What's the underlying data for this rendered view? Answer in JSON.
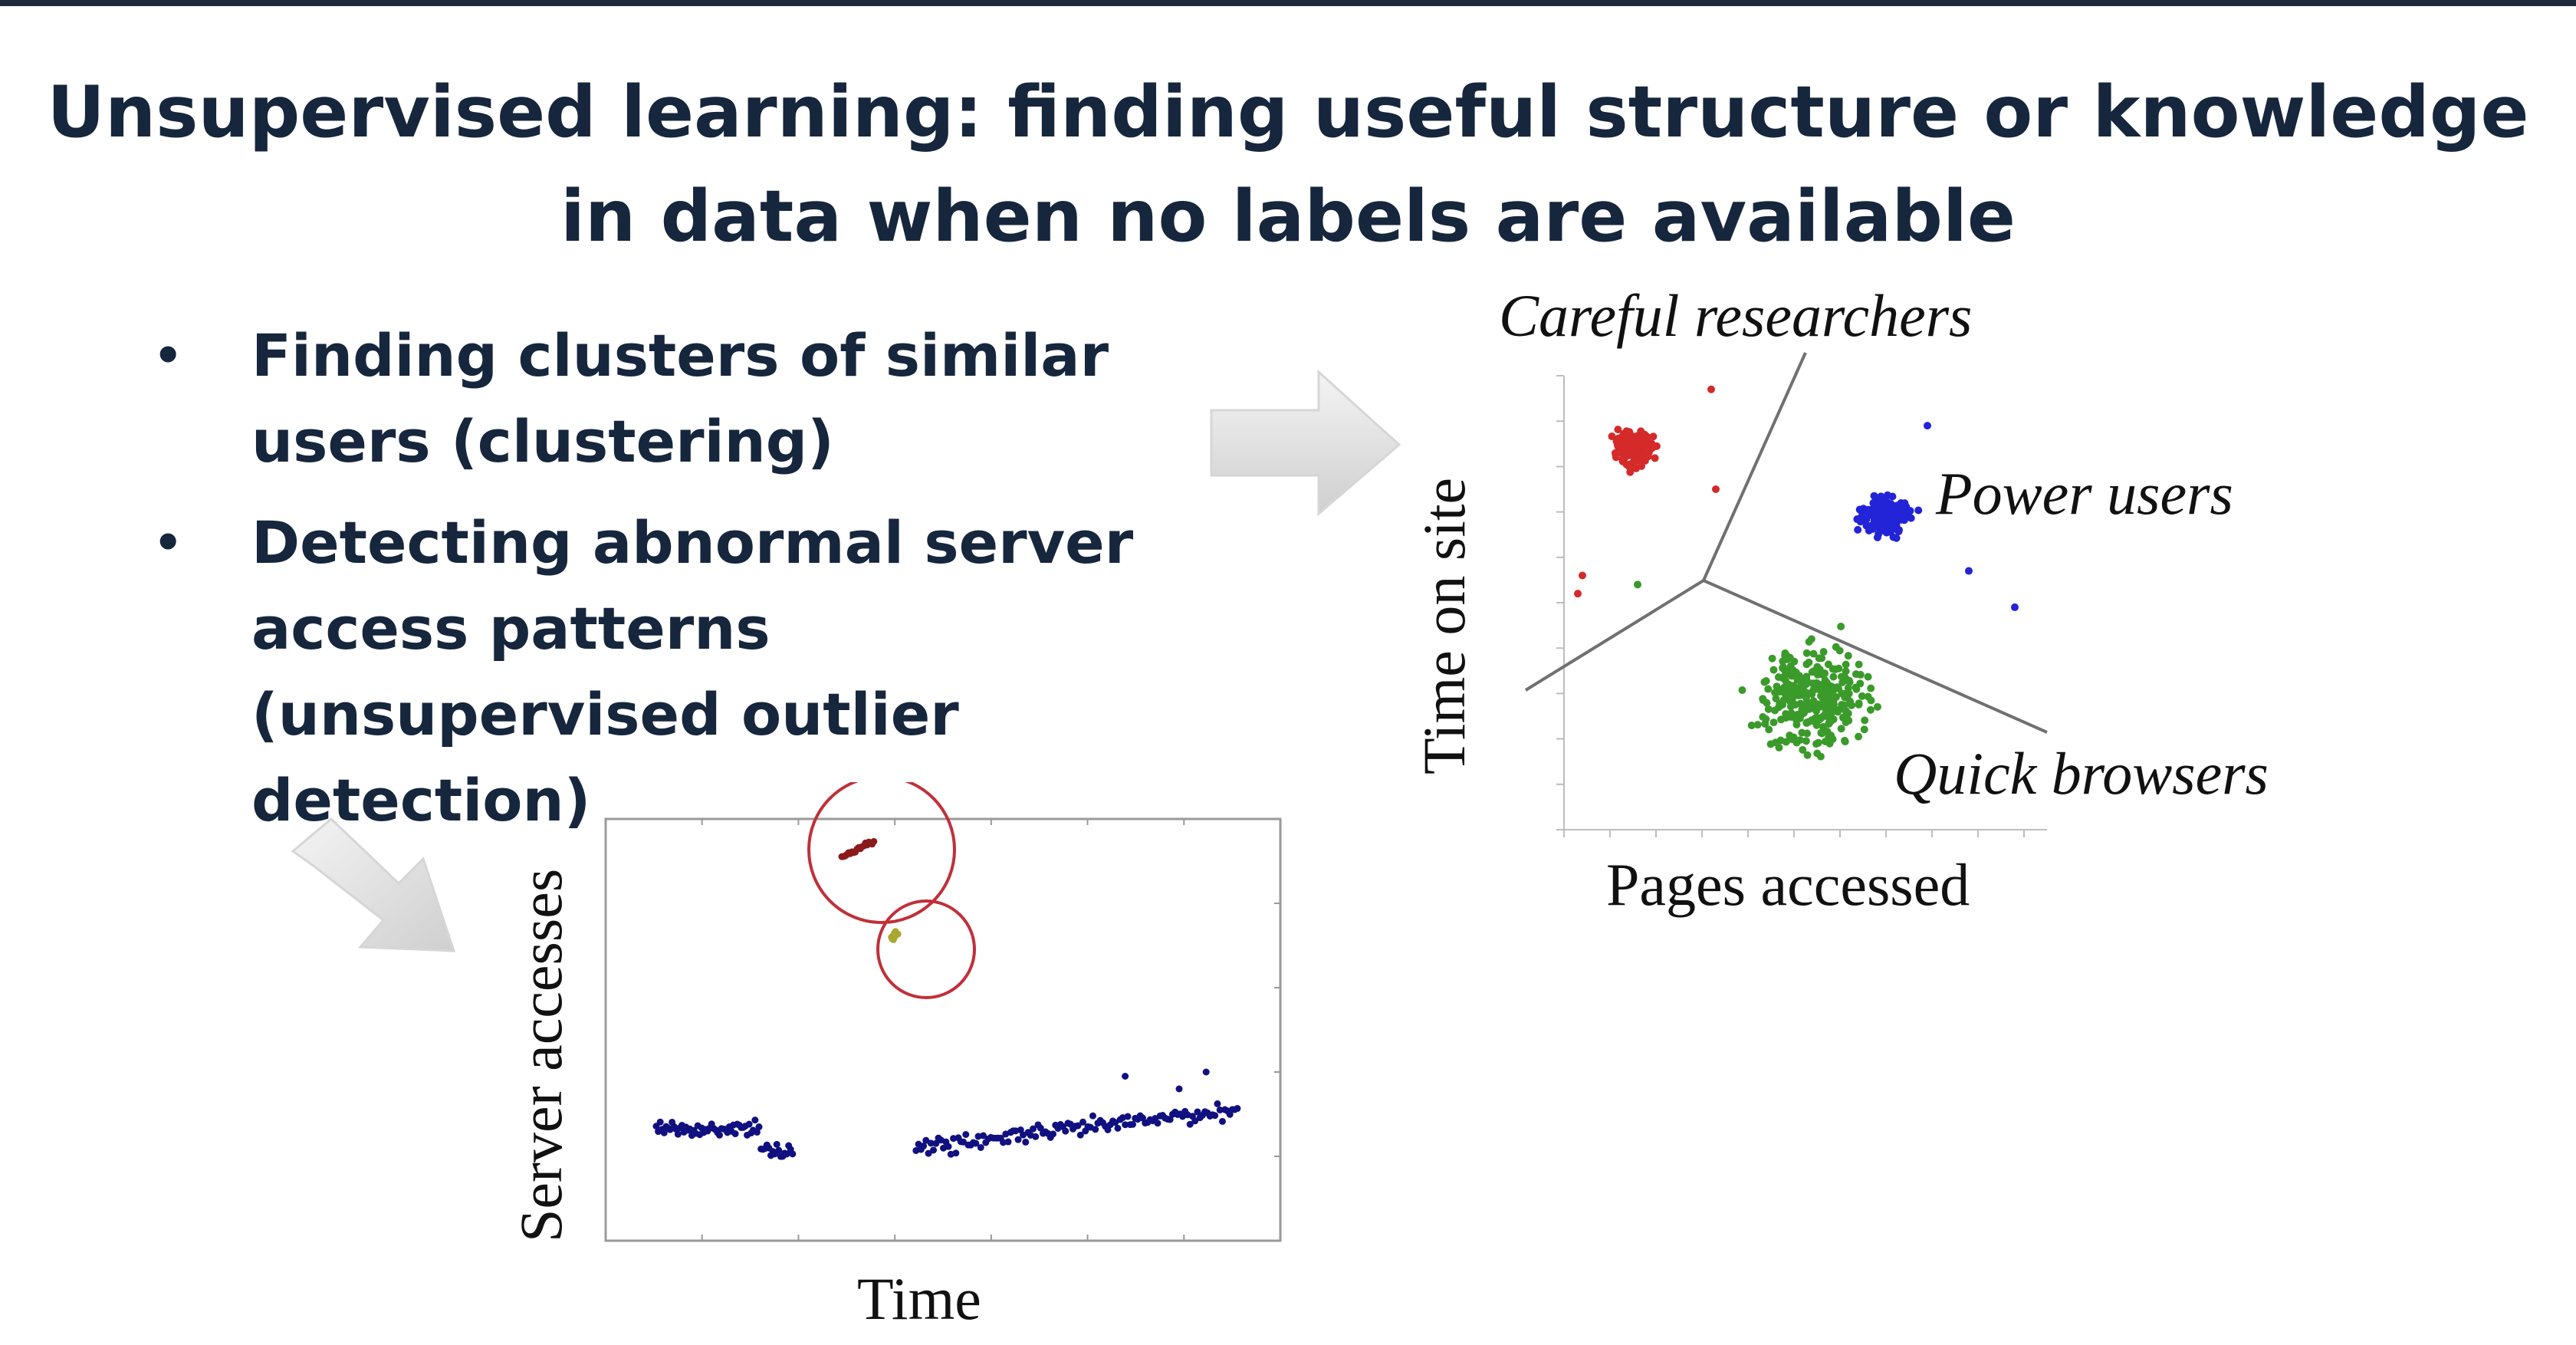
{
  "slide": {
    "title_lines": [
      "Unsupervised learning: finding useful structure or knowledge",
      "in data when no labels are available"
    ],
    "bullets": [
      {
        "lines": [
          "Finding clusters of similar",
          "users (clustering)"
        ]
      },
      {
        "lines": [
          "Detecting abnormal server",
          "access patterns",
          "(unsupervised outlier",
          "detection)"
        ]
      }
    ],
    "bullet_glyph": "•"
  },
  "colors": {
    "text": "#16263c",
    "red": "#d42a2a",
    "blue": "#2323d8",
    "green": "#3a9a2a",
    "dark_red": "#8b1a1a",
    "navy": "#101080",
    "olive": "#a8a830",
    "circle": "#c0303a"
  },
  "icons": [
    "right-arrow-icon",
    "down-right-arrow-icon"
  ],
  "chart_data": [
    {
      "type": "scatter",
      "xlabel": "Pages accessed",
      "ylabel": "Time on site",
      "annotations": [
        "Careful researchers",
        "Power users",
        "Quick browsers"
      ],
      "series": [
        {
          "color": "red",
          "cluster": "Careful researchers",
          "center": [
            1.5,
            8.4
          ],
          "spread": [
            0.35,
            0.35
          ],
          "n": 130
        },
        {
          "color": "blue",
          "cluster": "Power users",
          "center": [
            7.0,
            6.9
          ],
          "spread": [
            0.5,
            0.4
          ],
          "n": 160
        },
        {
          "color": "green",
          "cluster": "Quick browsers",
          "center": [
            5.4,
            2.9
          ],
          "spread": [
            1.1,
            1.1
          ],
          "n": 300
        }
      ],
      "xlim": [
        0,
        10
      ],
      "ylim": [
        0,
        10
      ]
    },
    {
      "type": "scatter",
      "xlabel": "Time",
      "ylabel": "Server accesses",
      "series": [
        {
          "name": "normal",
          "color": "navy",
          "segments": [
            [
              0.5,
              3.5,
              2.6
            ],
            [
              4.5,
              9.5,
              2.3
            ]
          ]
        },
        {
          "name": "outlier 1",
          "color": "dark_red",
          "points_near": [
            3.8,
            9.3
          ]
        },
        {
          "name": "outlier 2",
          "color": "olive",
          "points_near": [
            4.3,
            7.3
          ]
        }
      ],
      "xlim": [
        0,
        10
      ],
      "ylim": [
        0,
        10
      ]
    }
  ]
}
